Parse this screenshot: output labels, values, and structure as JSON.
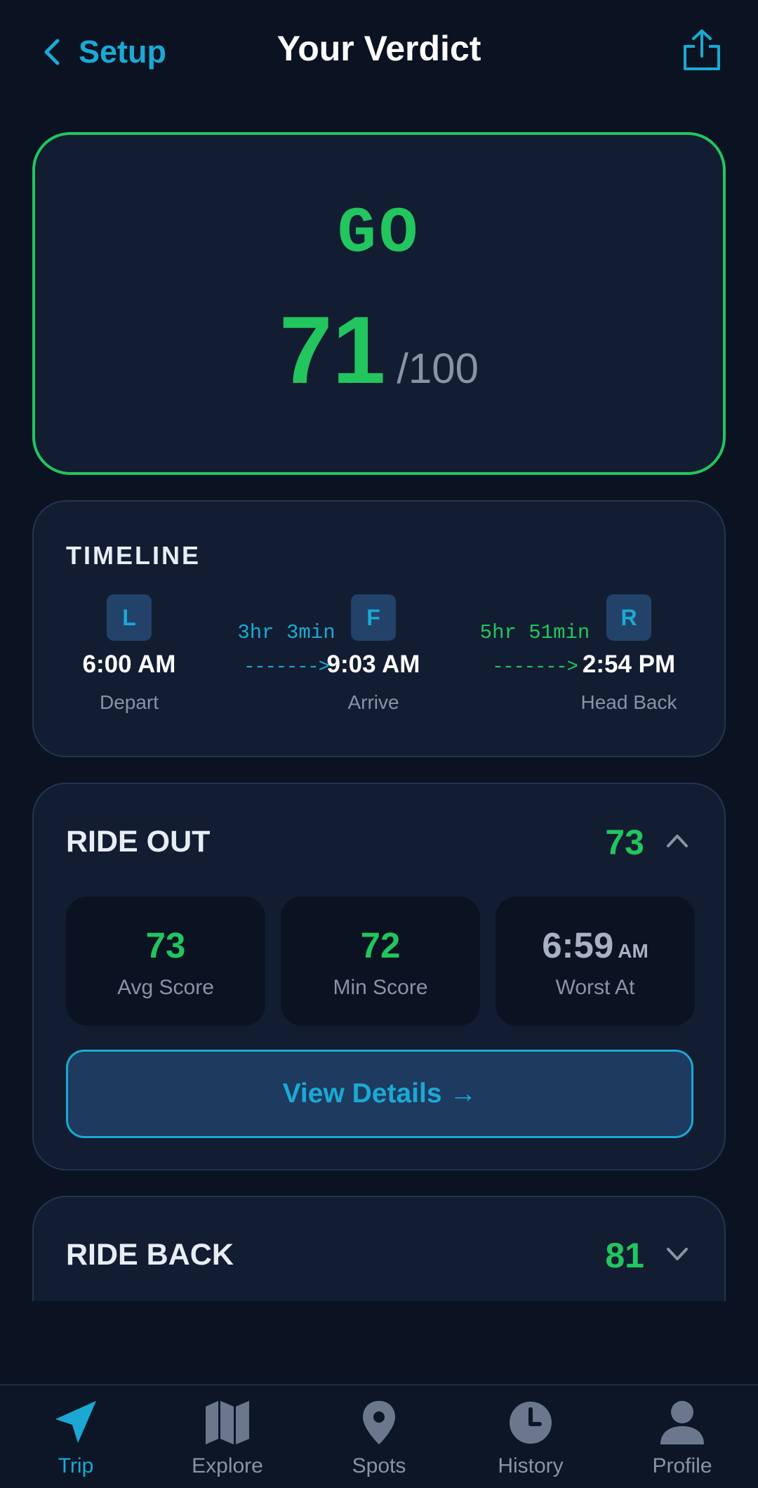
{
  "header": {
    "back_label": "Setup",
    "title": "Your Verdict",
    "back_icon": "chevron-left-icon",
    "share_icon": "share-icon"
  },
  "verdict": {
    "label": "GO",
    "score": "71",
    "max": "/100",
    "color": "#22c55e"
  },
  "timeline": {
    "title": "TIMELINE",
    "stops": [
      {
        "badge": "L",
        "time": "6:00 AM",
        "label": "Depart"
      },
      {
        "badge": "F",
        "time": "9:03 AM",
        "label": "Arrive"
      },
      {
        "badge": "R",
        "time": "2:54 PM",
        "label": "Head Back"
      }
    ],
    "legs": [
      {
        "duration": "3hr 3min",
        "arrow": "------->",
        "color": "#1ba9d4"
      },
      {
        "duration": "5hr 51min",
        "arrow": "------->",
        "color": "#22c55e"
      }
    ]
  },
  "ride_out": {
    "title": "RIDE OUT",
    "score": "73",
    "expanded": true,
    "stats": [
      {
        "value": "73",
        "unit": "",
        "label": "Avg Score"
      },
      {
        "value": "72",
        "unit": "",
        "label": "Min Score"
      },
      {
        "value": "6:59",
        "unit": "AM",
        "label": "Worst At"
      }
    ],
    "button_label": "View Details →"
  },
  "ride_back": {
    "title": "RIDE BACK",
    "score": "81",
    "expanded": false
  },
  "nav": {
    "items": [
      {
        "label": "Trip",
        "icon": "navigation-arrow-icon",
        "active": true
      },
      {
        "label": "Explore",
        "icon": "map-icon",
        "active": false
      },
      {
        "label": "Spots",
        "icon": "map-pin-icon",
        "active": false
      },
      {
        "label": "History",
        "icon": "clock-icon",
        "active": false
      },
      {
        "label": "Profile",
        "icon": "user-icon",
        "active": false
      }
    ]
  },
  "colors": {
    "background": "#0b1322",
    "card": "#131d31",
    "accent": "#1ba9d4",
    "good": "#22c55e",
    "muted": "#8893a6"
  }
}
